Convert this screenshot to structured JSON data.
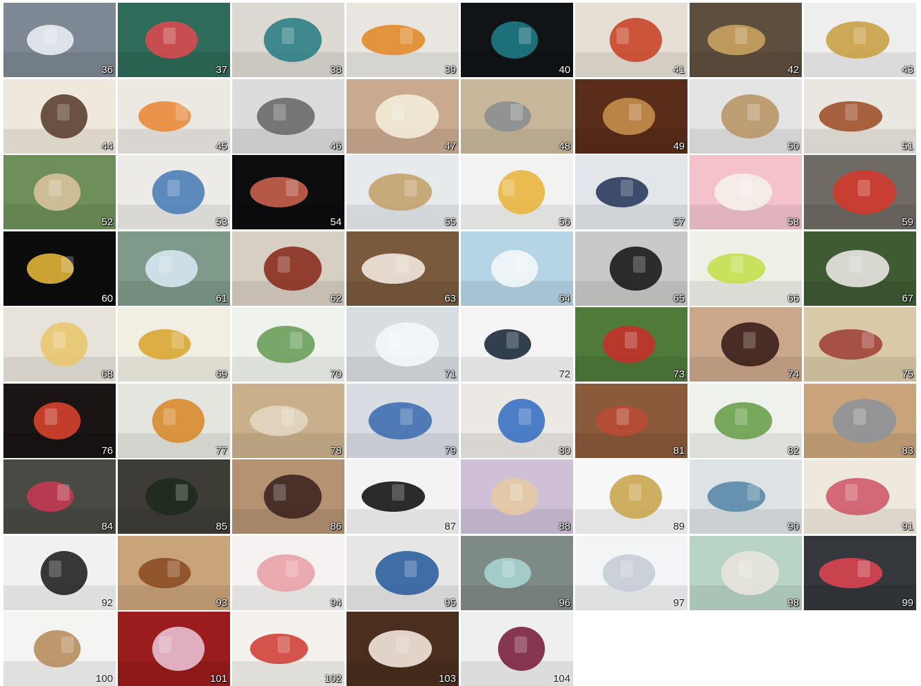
{
  "catalog": {
    "items": [
      {
        "number": "36",
        "icon": "sneakers-icon",
        "bg": "#7d8894",
        "fg": "#e9edf2",
        "light": false
      },
      {
        "number": "37",
        "icon": "wallet-icon",
        "bg": "#2e6b5a",
        "fg": "#d84a4f",
        "light": false
      },
      {
        "number": "38",
        "icon": "jewelry-pendant-icon",
        "bg": "#dcd9d2",
        "fg": "#2d7f86",
        "light": false
      },
      {
        "number": "39",
        "icon": "tea-box-icon",
        "bg": "#e9e6e2",
        "fg": "#e38a2b",
        "light": false
      },
      {
        "number": "40",
        "icon": "teapot-icon",
        "bg": "#101417",
        "fg": "#1f7a85",
        "light": false
      },
      {
        "number": "41",
        "icon": "fish-roe-icon",
        "bg": "#e6dfd5",
        "fg": "#c8452a",
        "light": false
      },
      {
        "number": "42",
        "icon": "wine-bottle-icon",
        "bg": "#5e4e3e",
        "fg": "#c9a25f",
        "light": false
      },
      {
        "number": "43",
        "icon": "gold-teapot-icon",
        "bg": "#eeeeee",
        "fg": "#c9a046",
        "light": false
      },
      {
        "number": "44",
        "icon": "gift-set-icon",
        "bg": "#efe8dc",
        "fg": "#5c4030",
        "light": false
      },
      {
        "number": "45",
        "icon": "toothbrush-icon",
        "bg": "#ece9e3",
        "fg": "#e98a3a",
        "light": false
      },
      {
        "number": "46",
        "icon": "golf-club-icon",
        "bg": "#dcdcdc",
        "fg": "#6a6a6a",
        "light": false
      },
      {
        "number": "47",
        "icon": "soap-bar-icon",
        "bg": "#c9aa8f",
        "fg": "#f2ecd7",
        "light": false
      },
      {
        "number": "48",
        "icon": "cutlery-icon",
        "bg": "#c8b79a",
        "fg": "#8b8f92",
        "light": false
      },
      {
        "number": "49",
        "icon": "bamboo-flute-icon",
        "bg": "#5a2c1a",
        "fg": "#c58e4d",
        "light": false
      },
      {
        "number": "50",
        "icon": "chopstick-rest-icon",
        "bg": "#e4e4e4",
        "fg": "#b99768",
        "light": false
      },
      {
        "number": "51",
        "icon": "tea-gift-box-icon",
        "bg": "#eae6e0",
        "fg": "#a0522d",
        "light": false
      },
      {
        "number": "52",
        "icon": "photo-frame-icon",
        "bg": "#6f8f5a",
        "fg": "#d8c29a",
        "light": false
      },
      {
        "number": "53",
        "icon": "jam-jar-icon",
        "bg": "#ecebe8",
        "fg": "#4d7fb8",
        "light": false
      },
      {
        "number": "54",
        "icon": "flower-box-icon",
        "bg": "#0d0d0f",
        "fg": "#c9604f",
        "light": false
      },
      {
        "number": "55",
        "icon": "clock-display-icon",
        "bg": "#e7eaed",
        "fg": "#c3a36d",
        "light": false
      },
      {
        "number": "56",
        "icon": "cosmetics-icon",
        "bg": "#f2f2f0",
        "fg": "#e9b53f",
        "light": false
      },
      {
        "number": "57",
        "icon": "mount-fuji-icon",
        "bg": "#e2e6ea",
        "fg": "#2b3b5c",
        "light": false
      },
      {
        "number": "58",
        "icon": "thermal-wear-icon",
        "bg": "#f3c2cb",
        "fg": "#f6f1ea",
        "light": false
      },
      {
        "number": "59",
        "icon": "daruma-icon",
        "bg": "#6f6a63",
        "fg": "#d23a2e",
        "light": false
      },
      {
        "number": "60",
        "icon": "gold-disc-icon",
        "bg": "#0c0c0c",
        "fg": "#e0b43a",
        "light": false
      },
      {
        "number": "61",
        "icon": "water-bottle-icon",
        "bg": "#7d9a8a",
        "fg": "#d6e6f0",
        "light": false
      },
      {
        "number": "62",
        "icon": "sauce-jar-icon",
        "bg": "#d7cfc3",
        "fg": "#8a2d1f",
        "light": false
      },
      {
        "number": "63",
        "icon": "reading-glasses-icon",
        "bg": "#7a5a3d",
        "fg": "#efe7dc",
        "light": false
      },
      {
        "number": "64",
        "icon": "water-drop-icon",
        "bg": "#b5d4e6",
        "fg": "#f2f7fa",
        "light": false
      },
      {
        "number": "65",
        "icon": "leather-case-icon",
        "bg": "#c9c9c9",
        "fg": "#1b1b1b",
        "light": false
      },
      {
        "number": "66",
        "icon": "food-cup-icon",
        "bg": "#eef0e6",
        "fg": "#c3e04e",
        "light": false
      },
      {
        "number": "67",
        "icon": "serum-bottle-icon",
        "bg": "#3e5b34",
        "fg": "#e8e6e0",
        "light": false
      },
      {
        "number": "68",
        "icon": "socks-icon",
        "bg": "#e8e3da",
        "fg": "#e9c66f",
        "light": false
      },
      {
        "number": "69",
        "icon": "shampoo-bottle-icon",
        "bg": "#f1efe2",
        "fg": "#d9a635",
        "light": false
      },
      {
        "number": "70",
        "icon": "stationery-set-icon",
        "bg": "#f0f2ee",
        "fg": "#6aa05a",
        "light": false
      },
      {
        "number": "71",
        "icon": "spray-bottle-icon",
        "bg": "#d8dde2",
        "fg": "#f5f7f9",
        "light": false
      },
      {
        "number": "72",
        "icon": "translator-device-icon",
        "bg": "#f4f4f4",
        "fg": "#1d2b3a",
        "light": true
      },
      {
        "number": "73",
        "icon": "greeting-card-icon",
        "bg": "#4f7a3a",
        "fg": "#c4312b",
        "light": false
      },
      {
        "number": "74",
        "icon": "vinegar-bottle-icon",
        "bg": "#caa78a",
        "fg": "#3b1f1a",
        "light": false
      },
      {
        "number": "75",
        "icon": "broom-icon",
        "bg": "#d9c9a6",
        "fg": "#a0443a",
        "light": false
      },
      {
        "number": "76",
        "icon": "canned-food-icon",
        "bg": "#1a1414",
        "fg": "#d6432c",
        "light": false
      },
      {
        "number": "77",
        "icon": "supplement-pack-icon",
        "bg": "#e5e5e0",
        "fg": "#d88a2e",
        "light": false
      },
      {
        "number": "78",
        "icon": "paint-set-icon",
        "bg": "#c9b08a",
        "fg": "#e2d6c0",
        "light": false
      },
      {
        "number": "79",
        "icon": "furoshiki-icon",
        "bg": "#d9dde3",
        "fg": "#3f6fb0",
        "light": false
      },
      {
        "number": "80",
        "icon": "sanitizer-bottle-icon",
        "bg": "#ece9e4",
        "fg": "#3a72c2",
        "light": false
      },
      {
        "number": "81",
        "icon": "gift-box-icon",
        "bg": "#8a5a3a",
        "fg": "#b94a35",
        "light": false
      },
      {
        "number": "82",
        "icon": "lotion-bottle-icon",
        "bg": "#eef1ec",
        "fg": "#6aa04c",
        "light": false
      },
      {
        "number": "83",
        "icon": "supplement-sticks-icon",
        "bg": "#c9a37a",
        "fg": "#8f949a",
        "light": false
      },
      {
        "number": "84",
        "icon": "tea-package-icon",
        "bg": "#4a4a44",
        "fg": "#c23a52",
        "light": false
      },
      {
        "number": "85",
        "icon": "seaweed-pack-icon",
        "bg": "#3d3c36",
        "fg": "#1d2a1c",
        "light": false
      },
      {
        "number": "86",
        "icon": "pen-case-icon",
        "bg": "#b59272",
        "fg": "#3d2620",
        "light": false
      },
      {
        "number": "87",
        "icon": "makeup-brush-icon",
        "bg": "#f3f3f3",
        "fg": "#151515",
        "light": true
      },
      {
        "number": "88",
        "icon": "body-brush-icon",
        "bg": "#cfc0d8",
        "fg": "#e4c9a5",
        "light": false
      },
      {
        "number": "89",
        "icon": "soy-sauce-bottle-icon",
        "bg": "#f7f7f7",
        "fg": "#c9a650",
        "light": true
      },
      {
        "number": "90",
        "icon": "tenugui-cloth-icon",
        "bg": "#dde2e4",
        "fg": "#5a8aa8",
        "light": false
      },
      {
        "number": "91",
        "icon": "hair-tie-icon",
        "bg": "#efe9dd",
        "fg": "#cf5b6a",
        "light": false
      },
      {
        "number": "92",
        "icon": "desk-lamp-icon",
        "bg": "#f1f1f1",
        "fg": "#222222",
        "light": true
      },
      {
        "number": "93",
        "icon": "diffuser-icon",
        "bg": "#c9a37a",
        "fg": "#8b4e24",
        "light": false
      },
      {
        "number": "94",
        "icon": "skincare-bottles-icon",
        "bg": "#f6f2f2",
        "fg": "#e8a2a8",
        "light": false
      },
      {
        "number": "95",
        "icon": "tablet-case-icon",
        "bg": "#e6e6e6",
        "fg": "#2e5f9e",
        "light": false
      },
      {
        "number": "96",
        "icon": "knit-sweater-icon",
        "bg": "#7e8a86",
        "fg": "#a7d3d0",
        "light": false
      },
      {
        "number": "97",
        "icon": "toothbrush-box-icon",
        "bg": "#f2f4f6",
        "fg": "#c7cdd6",
        "light": true
      },
      {
        "number": "98",
        "icon": "dollhouse-icon",
        "bg": "#b8d4c6",
        "fg": "#e8e4da",
        "light": false
      },
      {
        "number": "99",
        "icon": "bracelet-icon",
        "bg": "#34373c",
        "fg": "#d8454f",
        "light": false
      },
      {
        "number": "100",
        "icon": "wooden-chair-icon",
        "bg": "#f4f4f2",
        "fg": "#b88e5e",
        "light": true
      },
      {
        "number": "101",
        "icon": "shoe-deodorant-icon",
        "bg": "#9a1c1c",
        "fg": "#e8c0d2",
        "light": false
      },
      {
        "number": "102",
        "icon": "drink-bottles-icon",
        "bg": "#f4f1ec",
        "fg": "#d0423a",
        "light": false
      },
      {
        "number": "103",
        "icon": "coffee-cup-icon",
        "bg": "#4a2e1e",
        "fg": "#f2e6da",
        "light": false
      },
      {
        "number": "104",
        "icon": "panama-hat-icon",
        "bg": "#efefef",
        "fg": "#7a2140",
        "light": true
      }
    ]
  }
}
